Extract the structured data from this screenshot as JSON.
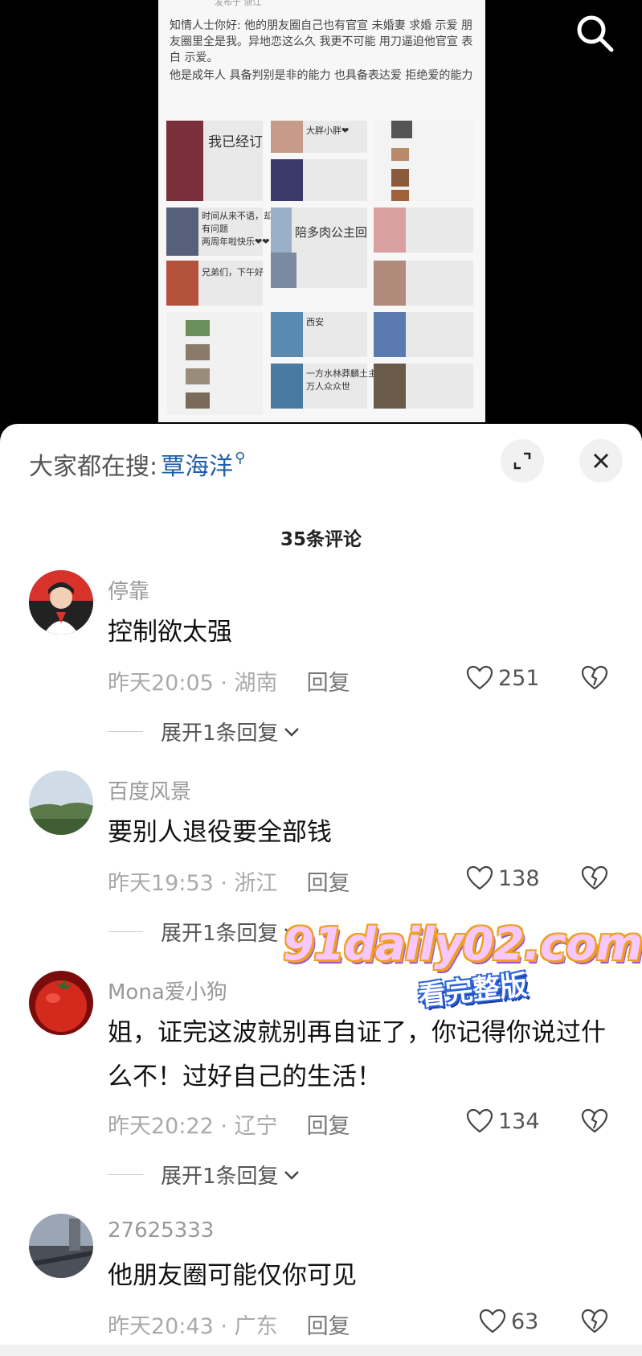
{
  "post": {
    "meta": "发布于 浙江",
    "paragraph1": "知情人士你好: 他的朋友圈自己也有官宣 未婚妻 求婚 示爱 朋友圈里全是我。异地恋这么久 我更不可能 用刀逼迫他官宣 表白 示爱。",
    "paragraph2": "他是成年人 具备判别是非的能力 也具备表达爱 拒绝爱的能力",
    "collage_captions": [
      "我已经订",
      "大胖小胖❤",
      "陪多肉公主回",
      "有问题",
      "两周年啦快乐❤❤",
      "兄弟们，下午好",
      "西安",
      "一方水林莽麟土主莽",
      "万人众众世",
      "时间从来不语，却"
    ]
  },
  "sheet": {
    "search_prefix": "大家都在搜:",
    "search_term": "覃海洋",
    "comment_count": "35条评论",
    "reply_label": "回复",
    "expand_label": "展开1条回复"
  },
  "comments": [
    {
      "user": "停靠",
      "text": "控制欲太强",
      "time": "昨天20:05 · 湖南",
      "likes": "251",
      "avatar": "child-avatar",
      "expand": true
    },
    {
      "user": "百度风景",
      "text": "要别人退役要全部钱",
      "time": "昨天19:53 · 浙江",
      "likes": "138",
      "avatar": "landscape-avatar",
      "expand": true
    },
    {
      "user": "Mona爱小狗",
      "text": "姐，证完这波就别再自证了，你记得你说过什么不！过好自己的生活！",
      "time": "昨天20:22 · 辽宁",
      "likes": "134",
      "avatar": "tomato-avatar",
      "expand": true
    },
    {
      "user": "27625333",
      "text": "他朋友圈可能仅你可见",
      "time": "昨天20:43 · 广东",
      "likes": "63",
      "avatar": "street-avatar",
      "expand": false
    }
  ],
  "watermark": {
    "url": "91daily02.com",
    "subtitle": "看完整版"
  },
  "colors": {
    "accent": "#1f5ea8",
    "sheet_bg": "#ffffff",
    "backdrop": "#000000"
  }
}
